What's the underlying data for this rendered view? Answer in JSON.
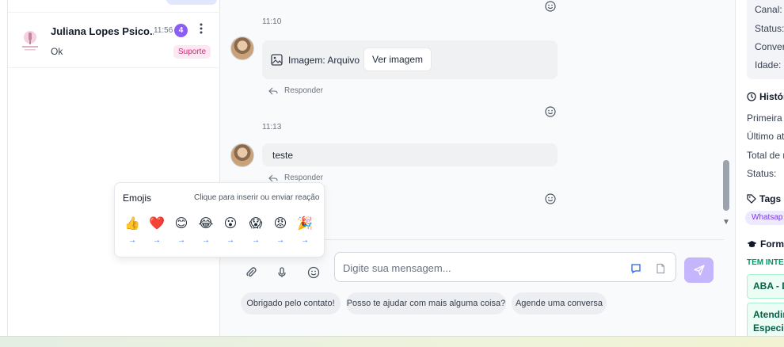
{
  "conversation_list": {
    "item": {
      "name": "Juliana Lopes Psico...",
      "time": "11:56",
      "unread": "4",
      "last_message": "Ok",
      "tag": "Suporte"
    }
  },
  "chat": {
    "messages": [
      {
        "time": "11:10",
        "type": "image",
        "caption": "Imagem: Arquivo",
        "button": "Ver imagem",
        "reply": "Responder"
      },
      {
        "time": "11:13",
        "type": "text",
        "text": "teste",
        "reply": "Responder"
      }
    ],
    "composer": {
      "placeholder": "Digite sua mensagem...",
      "quick_replies": [
        "Obrigado pelo contato!",
        "Posso te ajudar com mais alguma coisa?",
        "Agende uma conversa"
      ]
    }
  },
  "emoji_picker": {
    "title": "Emojis",
    "hint": "Clique para inserir ou enviar reação",
    "emojis": [
      "👍",
      "❤️",
      "😊",
      "😂",
      "😮",
      "😱",
      "😡",
      "🎉"
    ],
    "arrow": "→"
  },
  "details": {
    "fields": [
      "Canal:",
      "Status:",
      "Convers",
      "Idade:"
    ],
    "history_title": "Históri",
    "history_fields": [
      "Primeira c",
      "Último at",
      "Total de n",
      "Status:"
    ],
    "tags_title": "Tags",
    "tag": "Whatsap",
    "form_title": "Forma",
    "interest_label": "TEM INTER",
    "interests": [
      "ABA - D",
      "Atendin",
      "Especial"
    ]
  }
}
